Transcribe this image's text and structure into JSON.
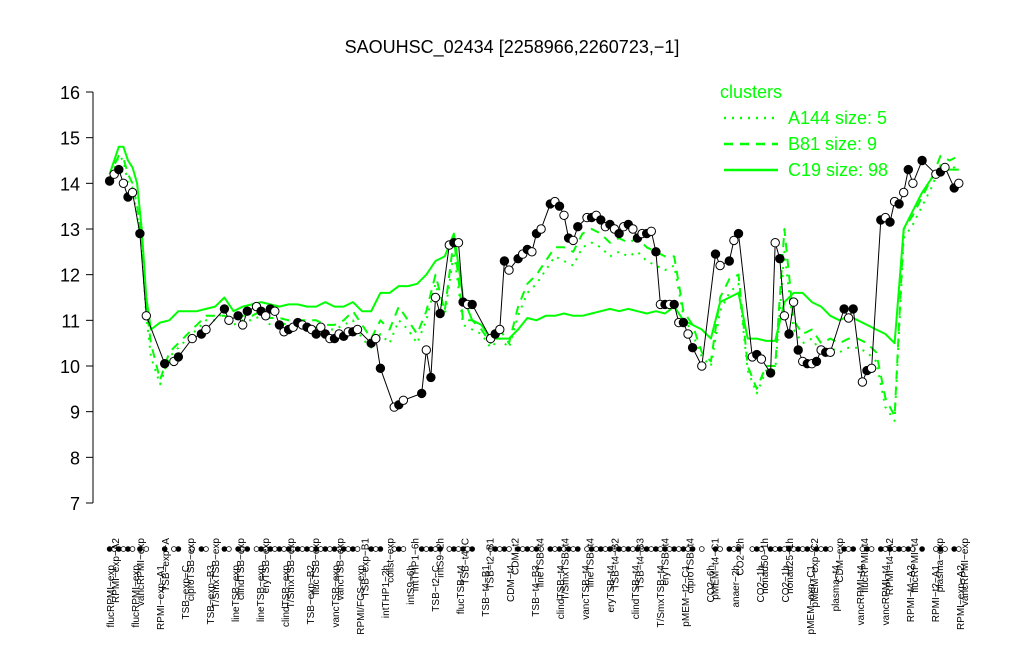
{
  "chart_data": {
    "type": "line",
    "title": "SAOUHSC_02434 [2258966,2260723,−1]",
    "xlabel": "",
    "ylabel": "",
    "ylim": [
      7,
      16
    ],
    "yticks": [
      "7",
      "8",
      "9",
      "10",
      "11",
      "12",
      "13",
      "14",
      "15",
      "16"
    ],
    "legend": {
      "title": "clusters",
      "placement": "top-right",
      "entries": [
        {
          "label": "A144 size: 5",
          "style": "dotted"
        },
        {
          "label": "B81 size: 9",
          "style": "dashed"
        },
        {
          "label": "C19 size: 98",
          "style": "solid"
        }
      ]
    },
    "colors": {
      "cluster_lines": "#00ff00",
      "points": "#000000"
    },
    "x_labels_upper": [
      "RPMI−exp−A2",
      "vancRPMI−exp",
      "TSB−exp−A",
      "ciproTSB−exp",
      "T/SmxTSB−exp",
      "clindTSB−exp",
      "eryTSB−exp",
      "T/SmxTSB−exp",
      "flucTSB−exp",
      "vancTSB−exp",
      "TSB−exp−B1",
      "colist−exp",
      "intTHP1−6h",
      "intS9−2h",
      "TSB−t4−C",
      "TSB−t2−B1",
      "CDM−t2",
      "lineTSB−t4",
      "T/SmxTSB−t4",
      "lineTSB−t4",
      "TSB−t4−B2",
      "TSB−t4−B3",
      "eryTSB−t4",
      "ciproTSB−t4",
      "pMEM−t4−C1",
      "CO2−2h",
      "nonad50−1h",
      "nonad25−1h",
      "pMEM−exp−C2",
      "CDM−exp",
      "flucRPMI−t4",
      "RPMI−t4−A2",
      "flucRPMI−t4",
      "plasma−exp",
      "vancRPMI−exp"
    ],
    "x_labels_lower": [
      "flucRPMI−exp",
      "flucRPMI−exp",
      "RPMI−exp−A1",
      "TSB−exp−C",
      "TSB−exp−B3",
      "lineTSB−exp",
      "lineTSB−exp",
      "clindTSB−exp",
      "TSB−exp−B2",
      "vancTSB−exp",
      "RPMI/FCS−exp",
      "intTHP1−2h",
      "intS9−6h",
      "TSB−t2−C",
      "flucTSB−t4",
      "TSB−t4−B1",
      "CDM−t4",
      "TSB−t4−B3",
      "clindTSB−t4",
      "vancTSB−t4",
      "eryTSB−t4",
      "clindTSB−t4",
      "T/SmxTSB−t4",
      "pMEM−t2−C1",
      "CO2−6h",
      "anaer−2h",
      "CO2−1h",
      "CO2−1h",
      "pMEM−exp−C1",
      "plasma−t4",
      "vancRPMI−t4",
      "vancRPMI−t4",
      "RPMI−t4−A2",
      "RPMI−t2−A1",
      "RPMI−exp−A2"
    ],
    "points": [
      [
        0.5,
        14.05
      ],
      [
        1,
        14.2
      ],
      [
        1.5,
        14.3
      ],
      [
        2,
        14.0
      ],
      [
        2.5,
        13.7
      ],
      [
        3,
        13.8
      ],
      [
        3.8,
        12.9
      ],
      [
        4.5,
        11.1
      ],
      [
        6.5,
        10.05
      ],
      [
        7.5,
        10.1
      ],
      [
        8,
        10.2
      ],
      [
        9.5,
        10.6
      ],
      [
        10.5,
        10.7
      ],
      [
        11,
        10.8
      ],
      [
        13,
        11.25
      ],
      [
        13.5,
        11.0
      ],
      [
        14.5,
        11.1
      ],
      [
        15,
        10.9
      ],
      [
        15.5,
        11.2
      ],
      [
        16.5,
        11.3
      ],
      [
        17,
        11.2
      ],
      [
        17.5,
        11.1
      ],
      [
        18,
        11.25
      ],
      [
        18.5,
        11.2
      ],
      [
        19,
        10.9
      ],
      [
        19.5,
        10.75
      ],
      [
        20,
        10.8
      ],
      [
        20.5,
        10.85
      ],
      [
        21,
        10.95
      ],
      [
        21.5,
        10.9
      ],
      [
        22,
        10.85
      ],
      [
        22.5,
        10.8
      ],
      [
        23,
        10.7
      ],
      [
        23.5,
        10.85
      ],
      [
        24,
        10.7
      ],
      [
        24.5,
        10.6
      ],
      [
        25,
        10.6
      ],
      [
        25.5,
        10.7
      ],
      [
        26,
        10.65
      ],
      [
        26.5,
        10.75
      ],
      [
        27,
        10.75
      ],
      [
        27.5,
        10.8
      ],
      [
        29,
        10.5
      ],
      [
        29.5,
        10.6
      ],
      [
        30,
        9.95
      ],
      [
        31.5,
        9.1
      ],
      [
        32,
        9.15
      ],
      [
        32.5,
        9.25
      ],
      [
        34.5,
        9.4
      ],
      [
        35,
        10.35
      ],
      [
        35.5,
        9.75
      ],
      [
        36,
        11.5
      ],
      [
        36.5,
        11.15
      ],
      [
        37.5,
        12.65
      ],
      [
        38,
        12.7
      ],
      [
        38.5,
        12.7
      ],
      [
        39,
        11.4
      ],
      [
        39.5,
        11.35
      ],
      [
        40,
        11.35
      ],
      [
        42,
        10.6
      ],
      [
        42.5,
        10.7
      ],
      [
        43,
        10.8
      ],
      [
        43.5,
        12.3
      ],
      [
        44,
        12.1
      ],
      [
        45,
        12.35
      ],
      [
        45.5,
        12.45
      ],
      [
        46,
        12.55
      ],
      [
        46.5,
        12.5
      ],
      [
        47,
        12.9
      ],
      [
        47.5,
        13.0
      ],
      [
        48.5,
        13.55
      ],
      [
        49,
        13.6
      ],
      [
        49.5,
        13.5
      ],
      [
        50,
        13.3
      ],
      [
        50.5,
        12.8
      ],
      [
        51,
        12.75
      ],
      [
        51.5,
        13.05
      ],
      [
        52.5,
        13.25
      ],
      [
        53,
        13.25
      ],
      [
        53.5,
        13.3
      ],
      [
        54,
        13.2
      ],
      [
        54.5,
        13.05
      ],
      [
        55,
        13.1
      ],
      [
        55.5,
        13.0
      ],
      [
        56,
        12.9
      ],
      [
        56.5,
        13.05
      ],
      [
        57,
        13.1
      ],
      [
        57.5,
        13.0
      ],
      [
        58,
        12.8
      ],
      [
        58.5,
        12.9
      ],
      [
        59,
        12.9
      ],
      [
        59.5,
        12.95
      ],
      [
        60,
        12.5
      ],
      [
        60.5,
        11.35
      ],
      [
        61,
        11.35
      ],
      [
        61.5,
        11.35
      ],
      [
        62,
        11.35
      ],
      [
        62.5,
        10.95
      ],
      [
        63,
        10.95
      ],
      [
        63.5,
        10.7
      ],
      [
        64,
        10.4
      ],
      [
        65,
        10.0
      ],
      [
        66.5,
        12.45
      ],
      [
        67,
        12.2
      ],
      [
        68,
        12.3
      ],
      [
        68.5,
        12.75
      ],
      [
        69,
        12.9
      ],
      [
        70.5,
        10.2
      ],
      [
        71,
        10.25
      ],
      [
        71.5,
        10.15
      ],
      [
        72.5,
        9.85
      ],
      [
        73,
        12.7
      ],
      [
        73.5,
        12.35
      ],
      [
        74,
        11.1
      ],
      [
        74.5,
        10.7
      ],
      [
        75,
        11.4
      ],
      [
        75.5,
        10.35
      ],
      [
        76,
        10.1
      ],
      [
        76.5,
        10.05
      ],
      [
        77,
        10.05
      ],
      [
        77.5,
        10.1
      ],
      [
        78,
        10.35
      ],
      [
        78.5,
        10.3
      ],
      [
        79,
        10.3
      ],
      [
        80.5,
        11.25
      ],
      [
        81,
        11.05
      ],
      [
        81.5,
        11.25
      ],
      [
        82.5,
        9.65
      ],
      [
        83,
        9.9
      ],
      [
        83.5,
        9.95
      ],
      [
        84.5,
        13.2
      ],
      [
        85,
        13.25
      ],
      [
        85.5,
        13.15
      ],
      [
        86,
        13.6
      ],
      [
        86.5,
        13.55
      ],
      [
        87,
        13.8
      ],
      [
        87.5,
        14.3
      ],
      [
        88,
        14.0
      ],
      [
        89,
        14.5
      ],
      [
        90.5,
        14.2
      ],
      [
        91,
        14.25
      ],
      [
        91.5,
        14.35
      ],
      [
        92.5,
        13.9
      ],
      [
        93,
        14.0
      ]
    ],
    "series": [
      {
        "name": "C19 size: 98",
        "style": "solid",
        "x": [
          0.5,
          1,
          1.5,
          2,
          2.5,
          3,
          3.5,
          4,
          4.5,
          5,
          6,
          7,
          8,
          9,
          10,
          11,
          12,
          13,
          14,
          15,
          16,
          17,
          18,
          19,
          20,
          21,
          22,
          23,
          24,
          25,
          26,
          27,
          28,
          29,
          30,
          31,
          32,
          33,
          34,
          35,
          36,
          37,
          38,
          39,
          40,
          41,
          42,
          43,
          44,
          45,
          46,
          47,
          48,
          49,
          50,
          51,
          52,
          53,
          54,
          55,
          56,
          57,
          58,
          59,
          60,
          61,
          62,
          63,
          64,
          65,
          66,
          67,
          68,
          69,
          70,
          71,
          72,
          73,
          74,
          75,
          76,
          77,
          78,
          79,
          80,
          81,
          82,
          83,
          84,
          85,
          86,
          87,
          88,
          89,
          90,
          91,
          92,
          93
        ],
        "values": [
          14.2,
          14.5,
          14.8,
          14.8,
          14.5,
          14.35,
          14.0,
          13.0,
          11.5,
          10.8,
          10.95,
          11.0,
          11.2,
          11.2,
          11.2,
          11.25,
          11.3,
          11.5,
          11.2,
          11.3,
          11.35,
          11.4,
          11.35,
          11.3,
          11.35,
          11.35,
          11.3,
          11.3,
          11.4,
          11.3,
          11.3,
          11.4,
          11.2,
          11.2,
          11.6,
          11.6,
          11.75,
          11.75,
          11.8,
          12.0,
          12.3,
          12.4,
          12.9,
          11.5,
          11.0,
          10.9,
          10.6,
          10.6,
          10.6,
          10.8,
          11.05,
          11.0,
          11.1,
          11.1,
          11.15,
          11.1,
          11.1,
          11.15,
          11.2,
          11.25,
          11.2,
          11.25,
          11.2,
          11.15,
          11.2,
          11.15,
          11.3,
          11.0,
          10.9,
          10.8,
          10.6,
          11.4,
          11.5,
          11.6,
          10.6,
          10.6,
          10.55,
          10.55,
          11.4,
          11.6,
          11.6,
          11.4,
          11.3,
          11.1,
          11.0,
          11.1,
          11.0,
          10.9,
          10.8,
          10.7,
          10.5,
          13.0,
          13.4,
          13.8,
          14.1,
          14.3,
          14.3,
          14.3
        ]
      },
      {
        "name": "B81 size: 9",
        "style": "dashed",
        "x": [
          0.5,
          1,
          1.5,
          2,
          2.5,
          3,
          3.5,
          4,
          4.5,
          5,
          6,
          7,
          8,
          9,
          10,
          11,
          12,
          13,
          14,
          15,
          16,
          17,
          18,
          19,
          20,
          21,
          22,
          23,
          24,
          25,
          26,
          27,
          28,
          29,
          30,
          31,
          32,
          33,
          34,
          35,
          36,
          37,
          38,
          39,
          40,
          41,
          42,
          43,
          44,
          45,
          46,
          47,
          48,
          49,
          50,
          51,
          52,
          53,
          54,
          55,
          56,
          57,
          58,
          59,
          60,
          61,
          62,
          63,
          64,
          65,
          66,
          67,
          68,
          69,
          70,
          71,
          72,
          73,
          74,
          75,
          76,
          77,
          78,
          79,
          80,
          81,
          82,
          83,
          84,
          85,
          86,
          87,
          88,
          89,
          90,
          91,
          92,
          93
        ],
        "values": [
          14.1,
          14.4,
          14.6,
          14.55,
          14.2,
          14.0,
          13.5,
          12.8,
          11.3,
          10.5,
          9.7,
          10.3,
          10.5,
          10.7,
          10.9,
          11.1,
          11.1,
          11.1,
          11.0,
          11.1,
          11.1,
          11.2,
          11.05,
          11.05,
          11.0,
          11.0,
          11.0,
          11.0,
          10.9,
          10.9,
          11.0,
          11.2,
          10.9,
          10.6,
          11.0,
          10.8,
          11.3,
          11.0,
          10.7,
          11.2,
          12.0,
          11.2,
          12.8,
          11.0,
          11.0,
          10.8,
          10.5,
          10.8,
          10.5,
          11.3,
          11.8,
          12.0,
          12.3,
          12.6,
          12.6,
          12.5,
          12.9,
          13.0,
          12.9,
          12.7,
          12.8,
          12.7,
          12.8,
          12.6,
          12.5,
          12.4,
          12.4,
          11.2,
          10.9,
          10.3,
          10.1,
          11.5,
          11.9,
          12.0,
          10.0,
          9.5,
          10.0,
          10.0,
          13.0,
          11.0,
          10.7,
          10.8,
          10.5,
          10.6,
          10.5,
          10.6,
          10.6,
          10.5,
          10.3,
          9.3,
          8.9,
          13.0,
          13.3,
          13.7,
          14.1,
          14.6,
          14.5,
          14.6
        ]
      },
      {
        "name": "A144 size: 5",
        "style": "dotted",
        "x": [
          0.5,
          1,
          1.5,
          2,
          2.5,
          3,
          3.5,
          4,
          4.5,
          5,
          6,
          7,
          8,
          9,
          10,
          11,
          12,
          13,
          14,
          15,
          16,
          17,
          18,
          19,
          20,
          21,
          22,
          23,
          24,
          25,
          26,
          27,
          28,
          29,
          30,
          31,
          32,
          33,
          34,
          35,
          36,
          37,
          38,
          39,
          40,
          41,
          42,
          43,
          44,
          45,
          46,
          47,
          48,
          49,
          50,
          51,
          52,
          53,
          54,
          55,
          56,
          57,
          58,
          59,
          60,
          61,
          62,
          63,
          64,
          65,
          66,
          67,
          68,
          69,
          70,
          71,
          72,
          73,
          74,
          75,
          76,
          77,
          78,
          79,
          80,
          81,
          82,
          83,
          84,
          85,
          86,
          87,
          88,
          89,
          90,
          91,
          92,
          93
        ],
        "values": [
          14.0,
          14.3,
          14.6,
          14.5,
          14.0,
          13.9,
          13.3,
          12.6,
          11.1,
          10.2,
          9.6,
          10.2,
          10.4,
          10.6,
          10.8,
          11.0,
          11.0,
          11.2,
          10.9,
          11.0,
          11.0,
          11.1,
          10.9,
          10.95,
          10.9,
          10.9,
          10.9,
          10.85,
          10.8,
          10.8,
          10.9,
          11.0,
          10.6,
          10.4,
          10.7,
          10.5,
          11.0,
          10.8,
          10.5,
          11.0,
          11.8,
          11.1,
          12.5,
          10.9,
          10.8,
          10.7,
          10.4,
          10.6,
          10.4,
          11.1,
          11.6,
          11.8,
          12.1,
          12.4,
          12.3,
          12.2,
          12.6,
          12.7,
          12.6,
          12.4,
          12.5,
          12.4,
          12.5,
          12.3,
          12.2,
          12.1,
          12.2,
          11.1,
          10.7,
          10.2,
          10.0,
          11.2,
          11.6,
          11.8,
          9.9,
          9.4,
          9.9,
          9.9,
          12.5,
          10.8,
          10.5,
          10.6,
          10.3,
          10.4,
          10.3,
          10.4,
          10.4,
          10.3,
          10.1,
          9.1,
          8.8,
          12.8,
          13.1,
          13.5,
          13.9,
          14.4,
          14.3,
          14.4
        ]
      }
    ],
    "x_range": [
      0,
      94
    ]
  }
}
